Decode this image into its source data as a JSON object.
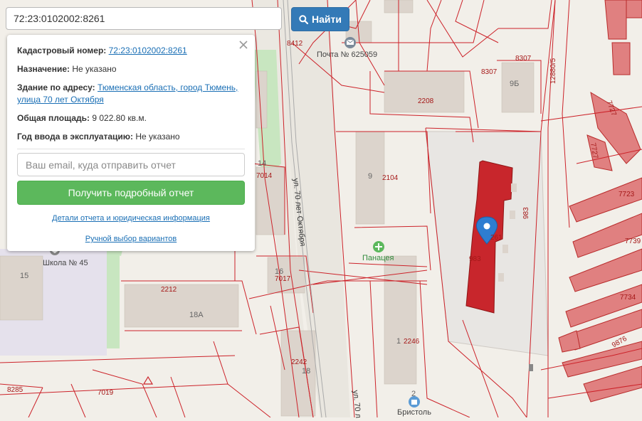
{
  "search": {
    "value": "72:23:0102002:8261",
    "button_label": "Найти"
  },
  "info_panel": {
    "cadastral_label": "Кадастровый номер:",
    "cadastral_value": "72:23:0102002:8261",
    "purpose_label": "Назначение:",
    "purpose_value": "Не указано",
    "building_label": "Здание по адресу:",
    "building_value_line1": "Тюменская область, город Тюмень,",
    "building_value_line2": "улица 70 лет Октября",
    "area_label": "Общая площадь:",
    "area_value": "9 022.80 кв.м.",
    "year_label": "Год ввода в эксплуатацию:",
    "year_value": "Не указано",
    "email_placeholder": "Ваш email, куда отправить отчет",
    "report_button_label": "Получить подробный отчет",
    "details_link": "Детали отчета и юридическая информация",
    "manual_link": "Ручной выбор вариантов"
  },
  "map": {
    "parcel_labels": [
      "8412",
      "8307",
      "8307",
      "12880/5",
      "7727",
      "7727",
      "2208",
      "2104",
      "7014",
      "983",
      "261",
      "983",
      "7723",
      "7739",
      "7734",
      "7017",
      "2212",
      "2246",
      "2242",
      "8285",
      "7019",
      "9876"
    ],
    "building_numbers": [
      "9Б",
      "14",
      "9",
      "16",
      "15",
      "18А",
      "1",
      "18",
      "2"
    ],
    "street_labels": [
      "ул. 70 лет Октября",
      "ул. 70 л"
    ],
    "poi_labels": [
      "Почта № 625059",
      "Панацея",
      "Школа № 45",
      "Бристоль"
    ],
    "colors": {
      "parcel_line": "#cc2229",
      "selected_building": "#c8262c",
      "building_fill": "#dcd4cc",
      "green_area": "#c8e6c0",
      "residential": "#e08080",
      "search_button": "#337ab7",
      "report_button": "#5cb85c",
      "link": "#1a6fb5"
    }
  }
}
